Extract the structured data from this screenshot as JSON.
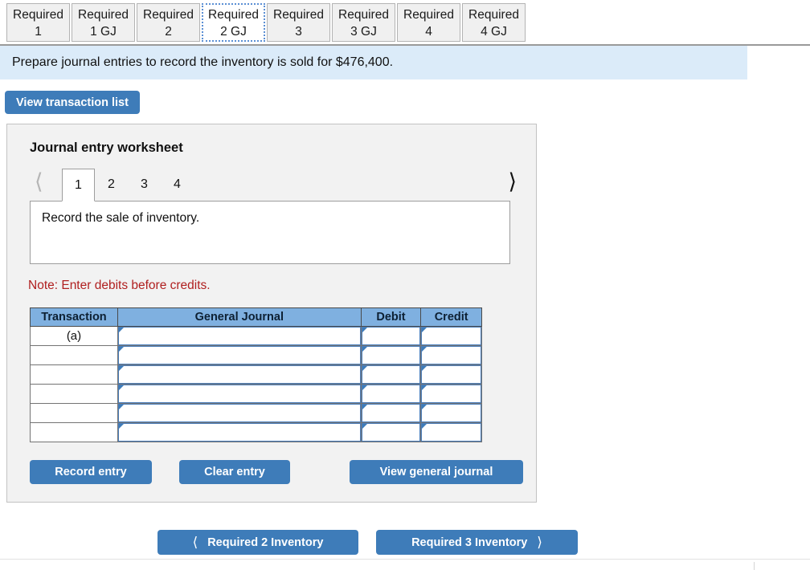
{
  "tabs": [
    {
      "line1": "Required",
      "line2": "1",
      "active": false
    },
    {
      "line1": "Required",
      "line2": "1 GJ",
      "active": false
    },
    {
      "line1": "Required",
      "line2": "2",
      "active": false
    },
    {
      "line1": "Required",
      "line2": "2 GJ",
      "active": true
    },
    {
      "line1": "Required",
      "line2": "3",
      "active": false
    },
    {
      "line1": "Required",
      "line2": "3 GJ",
      "active": false
    },
    {
      "line1": "Required",
      "line2": "4",
      "active": false
    },
    {
      "line1": "Required",
      "line2": "4 GJ",
      "active": false
    }
  ],
  "banner": {
    "text": "Prepare journal entries to record the inventory is sold for $476,400."
  },
  "toolbar": {
    "view_transaction_list_label": "View transaction list"
  },
  "worksheet": {
    "title": "Journal entry worksheet",
    "pager": {
      "prev_icon": "chevron-left",
      "next_icon": "chevron-right",
      "pages": [
        "1",
        "2",
        "3",
        "4"
      ],
      "active_page": "1"
    },
    "description": "Record the sale of inventory.",
    "note": "Note: Enter debits before credits.",
    "table": {
      "headers": [
        "Transaction",
        "General Journal",
        "Debit",
        "Credit"
      ],
      "rows": [
        {
          "transaction": "(a)",
          "general_journal": "",
          "debit": "",
          "credit": ""
        },
        {
          "transaction": "",
          "general_journal": "",
          "debit": "",
          "credit": ""
        },
        {
          "transaction": "",
          "general_journal": "",
          "debit": "",
          "credit": ""
        },
        {
          "transaction": "",
          "general_journal": "",
          "debit": "",
          "credit": ""
        },
        {
          "transaction": "",
          "general_journal": "",
          "debit": "",
          "credit": ""
        },
        {
          "transaction": "",
          "general_journal": "",
          "debit": "",
          "credit": ""
        }
      ]
    },
    "actions": {
      "record_entry": "Record entry",
      "clear_entry": "Clear entry",
      "view_general_journal": "View general journal"
    }
  },
  "bottom_nav": {
    "prev_arrow": "‹",
    "prev_label": "Required 2 Inventory",
    "next_label": "Required 3 Inventory",
    "next_arrow": "›"
  },
  "colors": {
    "accent_blue": "#3e7cb9",
    "banner_blue": "#dbebf9",
    "table_header_blue": "#7fb0e0",
    "note_red": "#b02020",
    "panel_gray": "#f2f2f2"
  }
}
